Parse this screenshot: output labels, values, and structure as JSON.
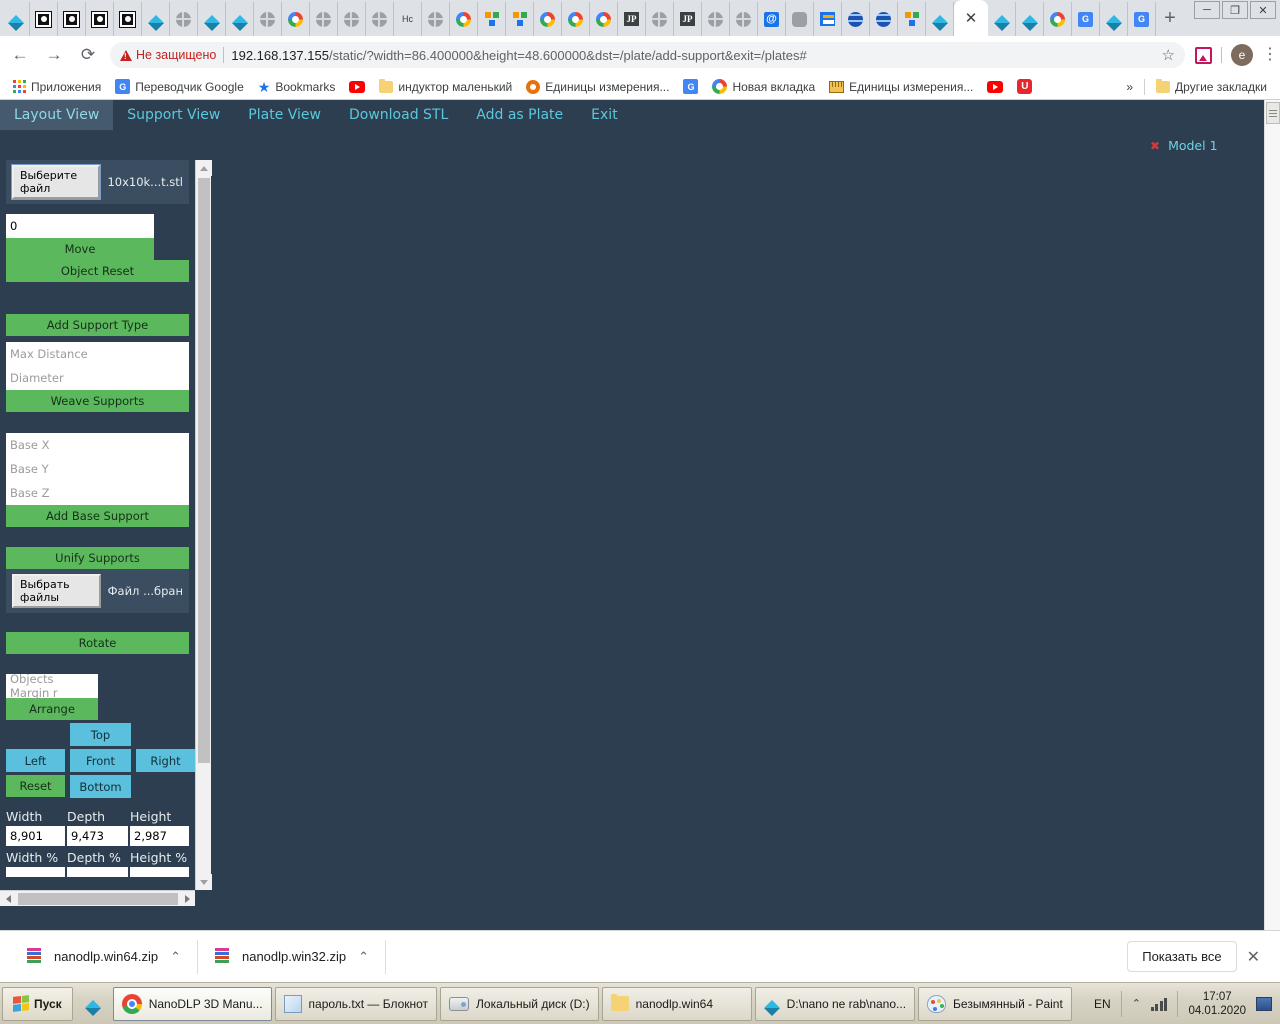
{
  "browser": {
    "tabs": [
      {
        "icon": "diamond-icon",
        "active": false
      },
      {
        "icon": "square-dot-icon",
        "active": false
      },
      {
        "icon": "square-dot-icon",
        "active": false
      },
      {
        "icon": "square-dot-icon",
        "active": false
      },
      {
        "icon": "square-dot-icon",
        "active": false
      },
      {
        "icon": "diamond-icon",
        "active": false
      },
      {
        "icon": "globe-icon",
        "active": false
      },
      {
        "icon": "diamond-icon",
        "active": false
      },
      {
        "icon": "diamond-icon",
        "active": false
      },
      {
        "icon": "globe-icon",
        "active": false
      },
      {
        "icon": "google-icon",
        "active": false
      },
      {
        "icon": "globe-icon",
        "active": false
      },
      {
        "icon": "globe-icon",
        "active": false
      },
      {
        "icon": "globe-icon",
        "active": false
      },
      {
        "icon": "text-ho-icon",
        "label": "Hc",
        "active": false
      },
      {
        "icon": "globe-icon",
        "active": false
      },
      {
        "icon": "google-icon",
        "active": false
      },
      {
        "icon": "google-slides-icon",
        "active": false
      },
      {
        "icon": "google-slides-icon",
        "active": false
      },
      {
        "icon": "google-icon",
        "active": false
      },
      {
        "icon": "google-icon",
        "active": false
      },
      {
        "icon": "google-icon",
        "active": false
      },
      {
        "icon": "jp-icon",
        "label": "JP",
        "active": false
      },
      {
        "icon": "globe-icon",
        "active": false
      },
      {
        "icon": "jp-icon",
        "label": "JP",
        "active": false
      },
      {
        "icon": "globe-icon",
        "active": false
      },
      {
        "icon": "globe-icon",
        "active": false
      },
      {
        "icon": "at-mail-icon",
        "label": "@",
        "active": false
      },
      {
        "icon": "gray-square-icon",
        "active": false
      },
      {
        "icon": "news-icon",
        "active": false
      },
      {
        "icon": "network-globe-icon",
        "active": false
      },
      {
        "icon": "network-globe-icon",
        "active": false
      },
      {
        "icon": "google-slides-icon",
        "active": false
      },
      {
        "icon": "diamond-icon",
        "active": false
      },
      {
        "icon": "close-icon",
        "label": "✕",
        "active": true
      },
      {
        "icon": "diamond-icon",
        "active": false
      },
      {
        "icon": "diamond-icon",
        "active": false
      },
      {
        "icon": "google-icon",
        "active": false
      },
      {
        "icon": "google-translate-icon",
        "label": "G",
        "active": false
      },
      {
        "icon": "diamond-icon",
        "active": false
      },
      {
        "icon": "google-translate-icon",
        "label": "G",
        "active": false
      }
    ],
    "new_tab_label": "+",
    "window_controls": {
      "minimize": "─",
      "maximize": "❐",
      "close": "✕"
    },
    "nav": {
      "back": "←",
      "forward": "→",
      "reload": "⟳"
    },
    "security_warning": "Не защищено",
    "url_host": "192.168.137.155",
    "url_path": "/static/?width=86.400000&height=48.600000&dst=/plate/add-support&exit=/plates#",
    "star_icon": "☆",
    "profile_initial": "e",
    "bookmarks": [
      {
        "label": "Приложения",
        "icon": "apps-grid-icon"
      },
      {
        "label": "Переводчик Google",
        "icon": "google-translate-icon"
      },
      {
        "label": "Bookmarks",
        "icon": "star-icon"
      },
      {
        "label": "",
        "icon": "youtube-icon"
      },
      {
        "label": "индуктор маленький",
        "icon": "folder-icon"
      },
      {
        "label": "Единицы измерения...",
        "icon": "gear-icon"
      },
      {
        "label": "",
        "icon": "google-translate-icon"
      },
      {
        "label": "Новая вкладка",
        "icon": "google-icon"
      },
      {
        "label": "Единицы измерения...",
        "icon": "ruler-icon"
      },
      {
        "label": "",
        "icon": "youtube-icon"
      },
      {
        "label": "",
        "icon": "u-icon"
      }
    ],
    "bookmarks_overflow": "»",
    "other_bookmarks": "Другие закладки"
  },
  "app": {
    "nav": [
      {
        "label": "Layout View",
        "active": true
      },
      {
        "label": "Support View",
        "active": false
      },
      {
        "label": "Plate View",
        "active": false
      },
      {
        "label": "Download STL",
        "active": false
      },
      {
        "label": "Add as Plate",
        "active": false
      },
      {
        "label": "Exit",
        "active": false
      }
    ],
    "file_upload": {
      "button": "Выберите файл",
      "filename": "10x10k...t.stl"
    },
    "move": {
      "value": "0",
      "button": "Move"
    },
    "object_reset_button": "Object Reset",
    "add_support_type_button": "Add Support Type",
    "weave": {
      "fields": [
        {
          "placeholder": "Max Distance"
        },
        {
          "placeholder": "Diameter"
        }
      ],
      "button": "Weave Supports"
    },
    "base": {
      "fields": [
        {
          "placeholder": "Base X"
        },
        {
          "placeholder": "Base Y"
        },
        {
          "placeholder": "Base Z"
        }
      ],
      "button": "Add Base Support"
    },
    "unify_supports_button": "Unify Supports",
    "multi_file": {
      "button": "Выбрать файлы",
      "status": "Файл ...бран"
    },
    "rotate_button": "Rotate",
    "arrange": {
      "placeholder": "Objects Margin r",
      "button": "Arrange"
    },
    "views": {
      "top": "Top",
      "left": "Left",
      "front": "Front",
      "right": "Right",
      "reset": "Reset",
      "bottom": "Bottom"
    },
    "dimensions": {
      "headers": [
        "Width",
        "Depth",
        "Height"
      ],
      "values": [
        "8,901",
        "9,473",
        "2,987"
      ],
      "percent_headers": [
        "Width %",
        "Depth %",
        "Height %"
      ]
    },
    "models": [
      {
        "name": "Model 1",
        "remove_icon": "✖"
      }
    ]
  },
  "downloads": {
    "items": [
      {
        "name": "nanodlp.win64.zip",
        "caret": "⌃"
      },
      {
        "name": "nanodlp.win32.zip",
        "caret": "⌃"
      }
    ],
    "show_all": "Показать все",
    "close": "✕"
  },
  "taskbar": {
    "start": "Пуск",
    "items": [
      {
        "label": "NanoDLP 3D Manu...",
        "icon": "chrome-icon",
        "active": true
      },
      {
        "label": "пароль.txt — Блокнот",
        "icon": "notepad-icon",
        "active": false
      },
      {
        "label": "Локальный диск (D:)",
        "icon": "drive-icon",
        "active": false
      },
      {
        "label": "nanodlp.win64",
        "icon": "folder-icon",
        "active": false
      },
      {
        "label": "D:\\nano ne rab\\nano...",
        "icon": "diamond-icon",
        "active": false
      },
      {
        "label": "Безымянный - Paint",
        "icon": "paint-icon",
        "active": false
      }
    ],
    "language": "EN",
    "time": "17:07",
    "date": "04.01.2020"
  },
  "colors": {
    "app_bg": "#2c3e50",
    "nav_active": "#465a6e",
    "nav_link": "#5bc8dd",
    "green_button": "#5cb85c",
    "blue_button": "#5bc0de",
    "model_label": "#6fd3e6",
    "warning_red": "#c5221f"
  }
}
